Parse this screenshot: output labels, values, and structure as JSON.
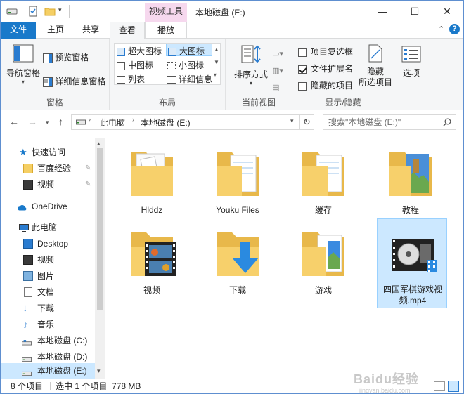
{
  "window": {
    "title": "本地磁盘 (E:)",
    "context_tab": "视频工具",
    "accent": "#1979ca",
    "context_color": "#f6d8ee"
  },
  "ribbon_tabs": [
    "文件",
    "主页",
    "共享",
    "查看",
    "播放"
  ],
  "ribbon": {
    "panes": {
      "nav_pane": "导航窗格",
      "preview_pane": "预览窗格",
      "details_pane": "详细信息窗格",
      "group": "窗格"
    },
    "layout": {
      "items": [
        "超大图标",
        "大图标",
        "中图标",
        "小图标",
        "列表",
        "详细信息"
      ],
      "selected": "大图标",
      "group": "布局"
    },
    "current_view": {
      "sort": "排序方式",
      "group": "当前视图"
    },
    "show_hide": {
      "item_checkbox": "项目复选框",
      "file_ext": "文件扩展名",
      "hidden_items": "隐藏的项目",
      "hide_selected_1": "隐藏",
      "hide_selected_2": "所选项目",
      "group": "显示/隐藏"
    },
    "options": "选项"
  },
  "address": {
    "path": [
      "此电脑",
      "本地磁盘 (E:)"
    ],
    "search_placeholder": "搜索\"本地磁盘 (E:)\""
  },
  "nav_pane": {
    "quick_access": "快速访问",
    "quick_items": [
      "百度经验",
      "视频"
    ],
    "onedrive": "OneDrive",
    "this_pc": "此电脑",
    "pc_items": [
      "Desktop",
      "视频",
      "图片",
      "文档",
      "下载",
      "音乐",
      "本地磁盘 (C:)",
      "本地磁盘 (D:)",
      "本地磁盘 (E:)"
    ],
    "selected": "本地磁盘 (E:)"
  },
  "files": [
    {
      "name": "Hlddz",
      "type": "folder"
    },
    {
      "name": "Youku Files",
      "type": "folder"
    },
    {
      "name": "缓存",
      "type": "folder"
    },
    {
      "name": "教程",
      "type": "folder"
    },
    {
      "name": "视频",
      "type": "folder"
    },
    {
      "name": "下载",
      "type": "folder"
    },
    {
      "name": "游戏",
      "type": "folder"
    },
    {
      "name": "四国军棋游戏视频.mp4",
      "type": "video",
      "selected": true
    }
  ],
  "status": {
    "count": "8 个项目",
    "selected": "选中 1 个项目",
    "size": "778 MB"
  },
  "watermark": {
    "text": "Baidu经验",
    "url": "jingyan.baidu.com"
  }
}
